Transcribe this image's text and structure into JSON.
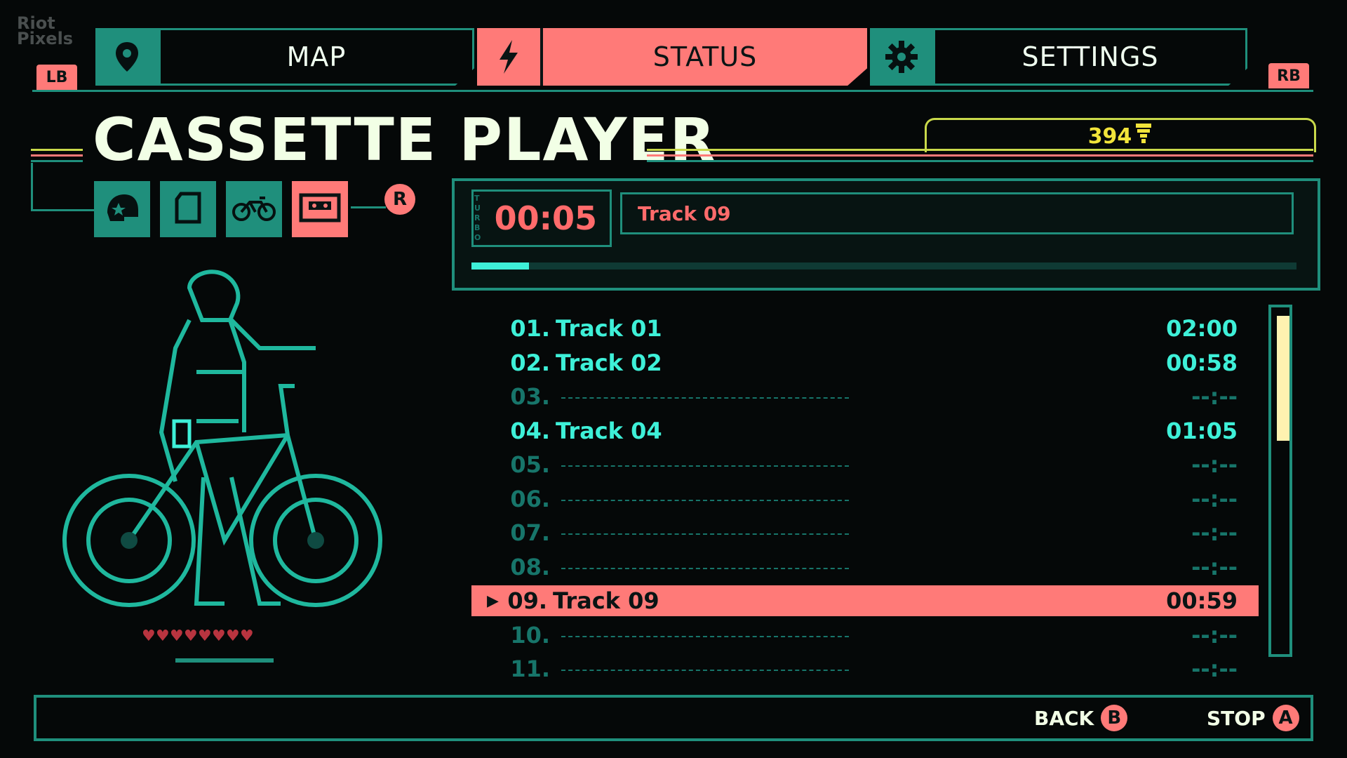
{
  "watermark": "Riot Pixels",
  "nav": {
    "lb": "LB",
    "rb": "RB",
    "tabs": [
      {
        "label": "MAP",
        "icon": "map-pin-icon"
      },
      {
        "label": "STATUS",
        "icon": "lightning-icon"
      },
      {
        "label": "SETTINGS",
        "icon": "gear-icon"
      }
    ],
    "active_tab": "STATUS"
  },
  "title": "CASSETTE PLAYER",
  "currency": {
    "amount": "394"
  },
  "item_icons": [
    "helmet-icon",
    "notebook-icon",
    "bike-icon",
    "cassette-icon"
  ],
  "r_button": "R",
  "player": {
    "time": "00:05",
    "track_name": "Track 09",
    "progress": 0.07,
    "turbo_label": "TURBO"
  },
  "tracks": [
    {
      "num": "01.",
      "name": "Track 01",
      "dur": "02:00",
      "unlocked": true
    },
    {
      "num": "02.",
      "name": "Track 02",
      "dur": "00:58",
      "unlocked": true
    },
    {
      "num": "03.",
      "name": "",
      "dur": "--:--",
      "unlocked": false
    },
    {
      "num": "04.",
      "name": "Track 04",
      "dur": "01:05",
      "unlocked": true
    },
    {
      "num": "05.",
      "name": "",
      "dur": "--:--",
      "unlocked": false
    },
    {
      "num": "06.",
      "name": "",
      "dur": "--:--",
      "unlocked": false
    },
    {
      "num": "07.",
      "name": "",
      "dur": "--:--",
      "unlocked": false
    },
    {
      "num": "08.",
      "name": "",
      "dur": "--:--",
      "unlocked": false
    },
    {
      "num": "09.",
      "name": "Track 09",
      "dur": "00:59",
      "unlocked": true,
      "selected": true
    },
    {
      "num": "10.",
      "name": "",
      "dur": "--:--",
      "unlocked": false
    },
    {
      "num": "11.",
      "name": "",
      "dur": "--:--",
      "unlocked": false
    }
  ],
  "hearts": 8,
  "footer": {
    "back_label": "BACK",
    "back_button": "B",
    "stop_label": "STOP",
    "stop_button": "A"
  },
  "colors": {
    "accent": "#ff7a78",
    "teal": "#1f8f7c",
    "cyan": "#3ef0d8",
    "gold": "#f2e43a"
  }
}
